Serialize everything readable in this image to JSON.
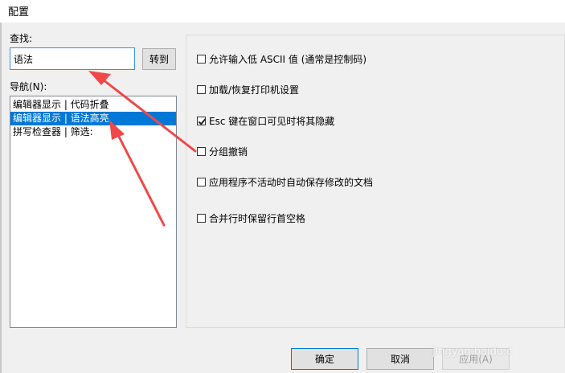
{
  "window": {
    "title": "配置"
  },
  "search": {
    "label": "查找:",
    "value": "语法",
    "goto_label": "转到"
  },
  "nav": {
    "label": "导航(N):",
    "items": [
      {
        "label": "编辑器显示 | 代码折叠",
        "selected": false
      },
      {
        "label": "编辑器显示 | 语法高亮",
        "selected": true
      },
      {
        "label": "拼写检查器 | 筛选:",
        "selected": false
      }
    ]
  },
  "options": [
    {
      "label": "允许输入低 ASCII 值 (通常是控制码)",
      "checked": false
    },
    {
      "label": "加载/恢复打印机设置",
      "checked": false
    },
    {
      "label": "Esc 键在窗口可见时将其隐藏",
      "checked": true
    },
    {
      "label": "分组撤销",
      "checked": false
    },
    {
      "label": "应用程序不活动时自动保存修改的文档",
      "checked": false
    },
    {
      "label": "合并行时保留行首空格",
      "checked": false
    }
  ],
  "buttons": {
    "ok": "确定",
    "cancel": "取消",
    "apply": "应用(A)"
  },
  "watermark": "jingyan.baidu.c",
  "colors": {
    "accent": "#0078d7",
    "annotation_arrow": "#f04848"
  }
}
